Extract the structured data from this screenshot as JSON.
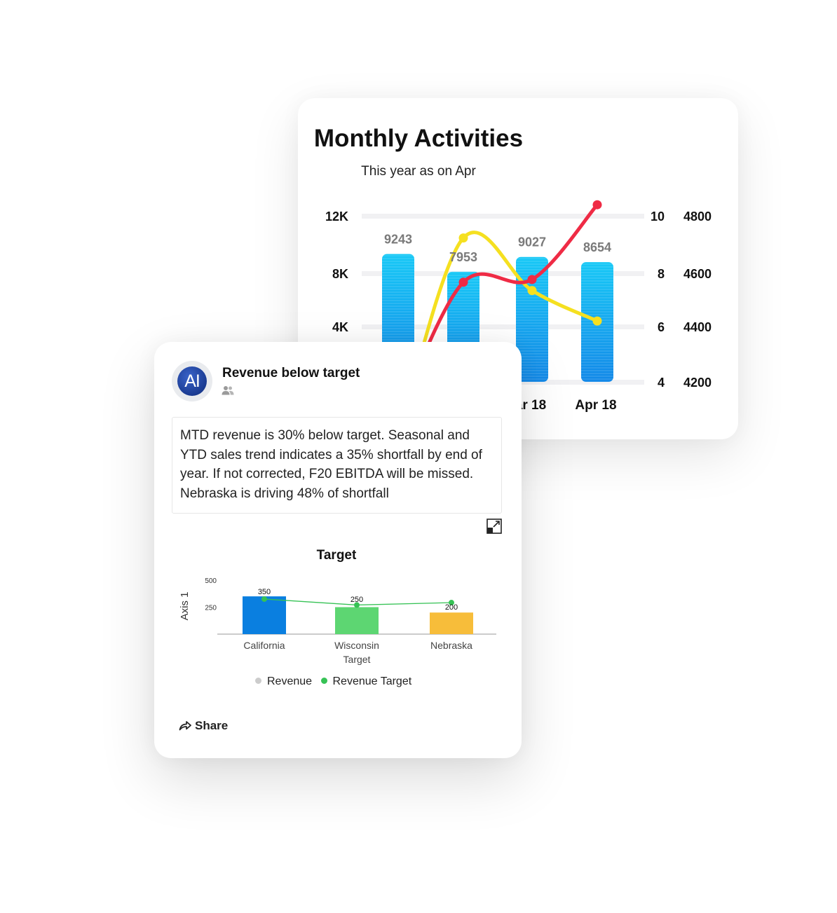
{
  "back_card": {
    "title": "Monthly Activities",
    "subtitle": "This year as on Apr"
  },
  "front_card": {
    "avatar_text": "AI",
    "alert_title": "Revenue below target",
    "description": "MTD revenue is 30% below target. Seasonal and YTD sales trend indicates a 35% shortfall by end of year. If not corrected, F20 EBITDA will be missed. Nebraska is driving 48% of shortfall",
    "share_label": "Share",
    "icons": {
      "people": "people-icon",
      "expand": "expand-icon",
      "share": "share-icon"
    }
  },
  "chart_data": [
    {
      "type": "bar",
      "title": "Monthly Activities",
      "subtitle": "This year as on Apr",
      "categories": [
        "",
        "",
        "ar 18",
        "Apr 18"
      ],
      "series": [
        {
          "values": [
            9243,
            7953,
            9027,
            8654
          ],
          "axis": "left",
          "color": "#1aa0ee",
          "data_labels": [
            "9243",
            "7953",
            "9027",
            "8654"
          ]
        },
        {
          "type": "line",
          "axis": "right1",
          "color": "#ef2b45",
          "values": [
            2.8,
            7.6,
            7.7,
            10.4
          ]
        },
        {
          "type": "line",
          "axis": "right1",
          "color": "#f5e020",
          "values": [
            2.0,
            9.2,
            7.3,
            6.2
          ]
        }
      ],
      "axes": {
        "left": {
          "ticks": [
            "12K",
            "8K",
            "4K"
          ],
          "tick_values": [
            12000,
            8000,
            4000
          ]
        },
        "right1": {
          "ticks": [
            "10",
            "8",
            "6",
            "4"
          ],
          "tick_values": [
            10,
            8,
            6,
            4
          ]
        },
        "right2": {
          "ticks": [
            "4800",
            "4600",
            "4400",
            "4200"
          ],
          "tick_values": [
            4800,
            4600,
            4400,
            4200
          ]
        }
      },
      "grid": true
    },
    {
      "type": "bar",
      "title": "Target",
      "ylabel": "Axis 1",
      "yticks": [
        "500",
        "250"
      ],
      "ytick_values": [
        500,
        250
      ],
      "ylim": [
        0,
        500
      ],
      "categories": [
        "California",
        "Wisconsin",
        "Nebraska"
      ],
      "xlabel": "Target",
      "series": [
        {
          "name": "Revenue",
          "values": [
            350,
            250,
            200
          ],
          "colors": [
            "#0a7fe0",
            "#5dd672",
            "#f7bd3a"
          ],
          "data_labels": [
            "350",
            "250",
            "200"
          ]
        },
        {
          "name": "Revenue Target",
          "type": "line",
          "values": [
            325,
            270,
            292
          ],
          "color": "#36c255"
        }
      ],
      "legend": [
        {
          "label": "Revenue",
          "color": "#cccccc"
        },
        {
          "label": "Revenue Target",
          "color": "#36c255"
        }
      ],
      "legend_position": "bottom"
    }
  ]
}
